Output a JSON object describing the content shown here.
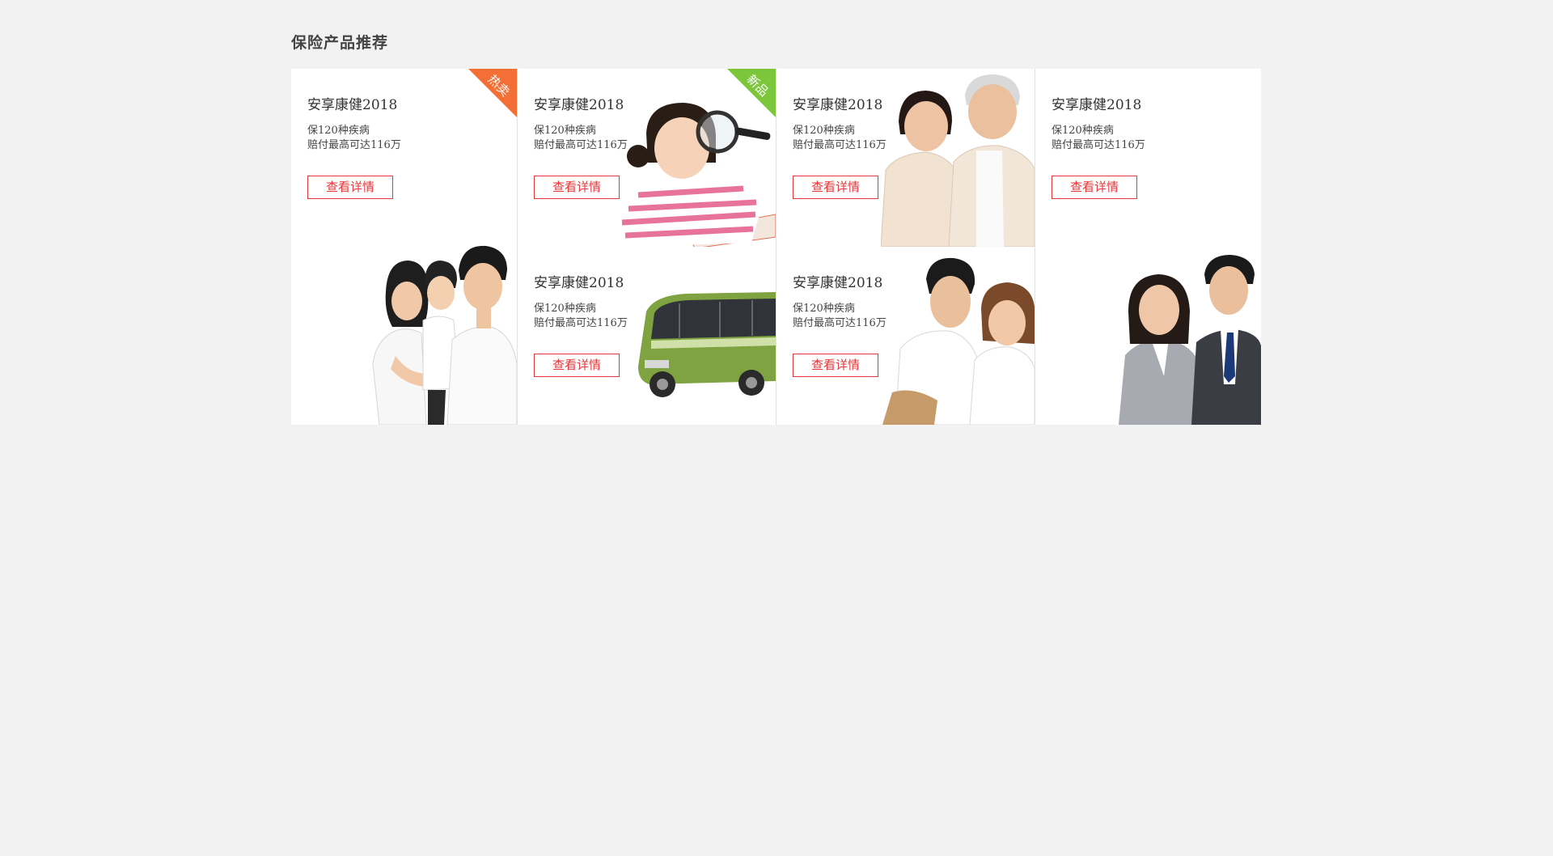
{
  "section": {
    "title": "保险产品推荐"
  },
  "cards": [
    {
      "title": "安享康健2018",
      "desc1": "保120种疾病",
      "desc2": "赔付最高可达116万",
      "button": "查看详情",
      "badge": "热卖",
      "badge_color": "#f36f36",
      "image": "family-of-three-photo"
    },
    {
      "title": "安享康健2018",
      "desc1": "保120种疾病",
      "desc2": "赔付最高可达116万",
      "button": "查看详情",
      "badge": "新品",
      "badge_color": "#7cc63c",
      "image": "girl-with-magnifier-photo"
    },
    {
      "title": "安享康健2018",
      "desc1": "保120种疾病",
      "desc2": "赔付最高可达116万",
      "button": "查看详情",
      "image": "green-bus-photo"
    },
    {
      "title": "安享康健2018",
      "desc1": "保120种疾病",
      "desc2": "赔付最高可达116万",
      "button": "查看详情",
      "image": "elderly-couple-photo"
    },
    {
      "title": "安享康健2018",
      "desc1": "保120种疾病",
      "desc2": "赔付最高可达116万",
      "button": "查看详情",
      "image": "young-couple-photo"
    },
    {
      "title": "安享康健2018",
      "desc1": "保120种疾病",
      "desc2": "赔付最高可达116万",
      "button": "查看详情",
      "image": "business-couple-photo"
    }
  ],
  "colors": {
    "accent": "#e5383b",
    "background": "#f2f2f2",
    "card": "#ffffff"
  }
}
